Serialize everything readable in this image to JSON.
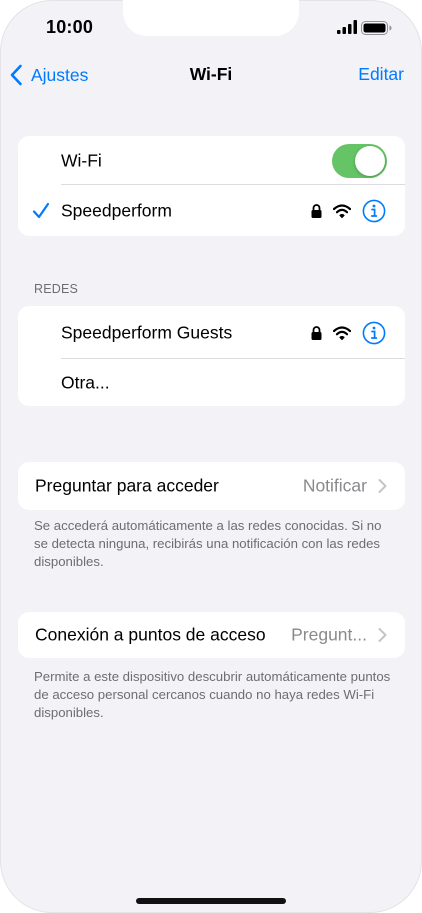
{
  "status_bar": {
    "time": "10:00",
    "signal_icon": "cellular-signal-icon",
    "battery_icon": "battery-icon"
  },
  "nav": {
    "back_label": "Ajustes",
    "title": "Wi-Fi",
    "edit_label": "Editar"
  },
  "wifi_group": {
    "toggle_label": "Wi-Fi",
    "toggle_on": true,
    "connected_network": "Speedperform",
    "connected_icons": [
      "checkmark-icon",
      "lock-icon",
      "wifi-icon",
      "info-icon"
    ]
  },
  "networks_section": {
    "header": "REDES",
    "items": [
      {
        "label": "Speedperform Guests",
        "secured": true
      },
      {
        "label": "Otra..."
      }
    ]
  },
  "ask_to_join": {
    "label": "Preguntar para acceder",
    "value": "Notificar",
    "footer": "Se accederá automáticamente a las redes conocidas. Si no se detecta ninguna, recibirás una notificación con las redes disponibles."
  },
  "hotspot": {
    "label": "Conexión a puntos de acceso",
    "value": "Pregunt...",
    "footer": "Permite a este dispositivo descubrir automáticamente puntos de acceso personal cercanos cuando no haya redes Wi-Fi disponibles."
  },
  "colors": {
    "accent": "#007aff",
    "toggle_on": "#65c466",
    "background": "#f2f2f7",
    "secondary_text": "#6d6d72"
  }
}
